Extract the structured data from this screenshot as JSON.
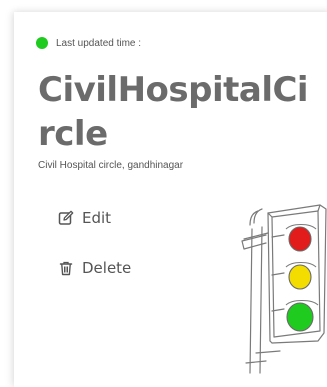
{
  "status": {
    "label": "Last updated time :",
    "indicator_color": "#1ecb1e"
  },
  "location": {
    "title": "CivilHospitalCircle",
    "address": "Civil Hospital circle, gandhinagar"
  },
  "actions": {
    "edit_label": "Edit",
    "edit_icon": "edit-icon",
    "delete_label": "Delete",
    "delete_icon": "trash-icon"
  },
  "illustration": {
    "name": "traffic-light-illustration",
    "lights": [
      "#e21b1b",
      "#f3dc00",
      "#1ecb1e"
    ]
  }
}
